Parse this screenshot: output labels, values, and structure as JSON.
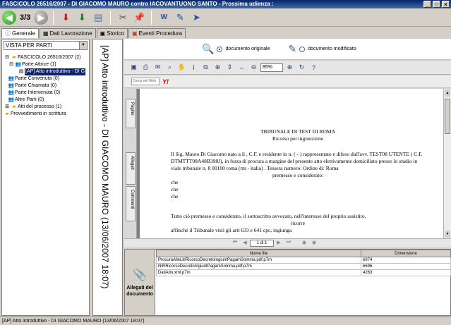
{
  "window": {
    "title": "FASCICOLO 26516/2007 - DI GIACOMO MAURO contro IACOVANTUONO SANTO - Prossima udienza :"
  },
  "toolbar": {
    "counter": "3/3"
  },
  "tabs": [
    {
      "label": "Generale",
      "icon": "info-icon"
    },
    {
      "label": "Dati Lavorazione",
      "icon": "list-icon"
    },
    {
      "label": "Storico",
      "icon": "calendar-icon"
    },
    {
      "label": "Eventi Procedura",
      "icon": "event-icon"
    }
  ],
  "sidebar": {
    "view_select": "VISTA PER PARTI",
    "tree": {
      "root": "FASCICOLO 26516/2007 (2)",
      "parte_attrice": "Parte Attrice (1)",
      "selected_doc": "[AP] Atto introduttivo - DI G",
      "parte_convenuta": "Parte Convenuta (0)",
      "parte_chiamata": "Parte Chiamata (0)",
      "parte_intervenuta": "Parte Intervenuta (0)",
      "altre_parti": "Altre Parti (0)",
      "atti_processo": "Atti del processo (1)",
      "provvedimenti": "Provvedimenti in scrittura"
    }
  },
  "vertical_title": "[AP] Atto introduttivo - DI GIACOMO MAURO (13/06/2007 18:07)",
  "doc_options": {
    "original": "documento originale",
    "modified": "documento modificato"
  },
  "pdf": {
    "zoom": "85%",
    "search_placeholder": "Cerca nel Web",
    "yahoo": "Y!",
    "side_tabs": {
      "pages": "Pagine",
      "attachments": "Allegati",
      "comments": "Commenti"
    },
    "page_indicator": "1 di 1",
    "content": {
      "title": "TRIBUNALE DI TEST DI ROMA",
      "subtitle": "Ricorso per ingiunzione",
      "para1": "Il Sig. Mauro Di Giacomo nato a   il , C.F.   e residente in   n.    ( - ) rappresentato e difeso dall'avv. TEST08 UTENTE ( C.F. DTMTTT08A48B398J), in forza di procura a margine del presente atto elettivamente domiciliato presso lo studio in viale tribunale  n. 8 00100 roma (rm - italia) . Tessera numero:  Ordine di: Roma",
      "premesso": "premesso e considerato:",
      "che1": "che",
      "che2": "che",
      "che3": "che",
      "para2": "Tutto ciò premesso e considerato, il sottoscritto avvocato, nell'interesse del proprio assistito,",
      "ricorre": "ricorre",
      "para3": "affinché il Tribunale visti gli artt 633 e 641 cpc, ingiunga"
    }
  },
  "attachments": {
    "label_line1": "Allegati del",
    "label_line2": "documento",
    "columns": [
      "Nome file",
      "Dimensione"
    ],
    "rows": [
      [
        "ProcuraAlleLitiRicorsoDecretoIngiuntPagamSomma.pdf.p7m",
        "6974"
      ],
      [
        "NIRRicorsoDecretoIngiuntPagamSomma.pdf.p7m",
        "6696"
      ],
      [
        "DatiAtto.xml.p7m",
        "4263"
      ]
    ]
  },
  "statusbar": "[AP] Atto introduttivo - DI GIACOMO MAURO (13/06/2007 18:07)"
}
